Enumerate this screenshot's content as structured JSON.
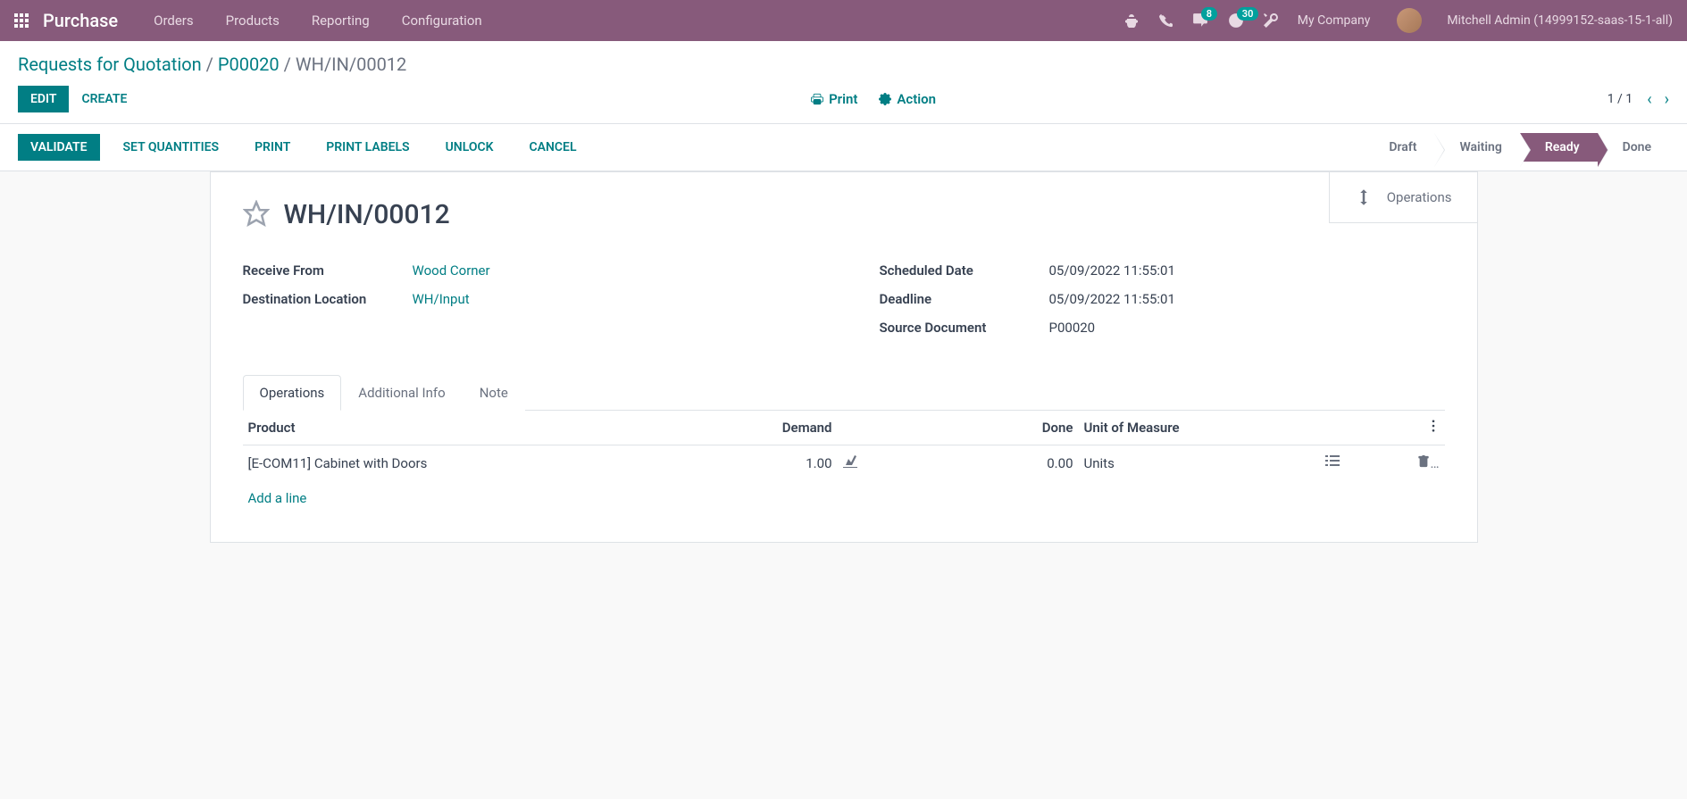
{
  "nav": {
    "app_name": "Purchase",
    "items": [
      "Orders",
      "Products",
      "Reporting",
      "Configuration"
    ],
    "chat_badge": "8",
    "clock_badge": "30",
    "company": "My Company",
    "username": "Mitchell Admin (14999152-saas-15-1-all)"
  },
  "breadcrumb": {
    "root": "Requests for Quotation",
    "parent": "P00020",
    "current": "WH/IN/00012"
  },
  "buttons": {
    "edit": "Edit",
    "create": "Create",
    "print": "Print",
    "action": "Action",
    "validate": "Validate",
    "set_quantities": "Set Quantities",
    "print2": "Print",
    "print_labels": "Print Labels",
    "unlock": "Unlock",
    "cancel": "Cancel"
  },
  "pager": {
    "text": "1 / 1"
  },
  "status": {
    "draft": "Draft",
    "waiting": "Waiting",
    "ready": "Ready",
    "done": "Done"
  },
  "stat": {
    "operations": "Operations"
  },
  "doc": {
    "title": "WH/IN/00012",
    "receive_from_label": "Receive From",
    "receive_from": "Wood Corner",
    "dest_label": "Destination Location",
    "dest": "WH/Input",
    "scheduled_label": "Scheduled Date",
    "scheduled": "05/09/2022 11:55:01",
    "deadline_label": "Deadline",
    "deadline": "05/09/2022 11:55:01",
    "source_label": "Source Document",
    "source": "P00020"
  },
  "tabs": {
    "operations": "Operations",
    "additional": "Additional Info",
    "note": "Note"
  },
  "table": {
    "headers": {
      "product": "Product",
      "demand": "Demand",
      "done": "Done",
      "uom": "Unit of Measure"
    },
    "rows": [
      {
        "product": "[E-COM11] Cabinet with Doors",
        "demand": "1.00",
        "done": "0.00",
        "uom": "Units"
      }
    ],
    "add_line": "Add a line"
  }
}
